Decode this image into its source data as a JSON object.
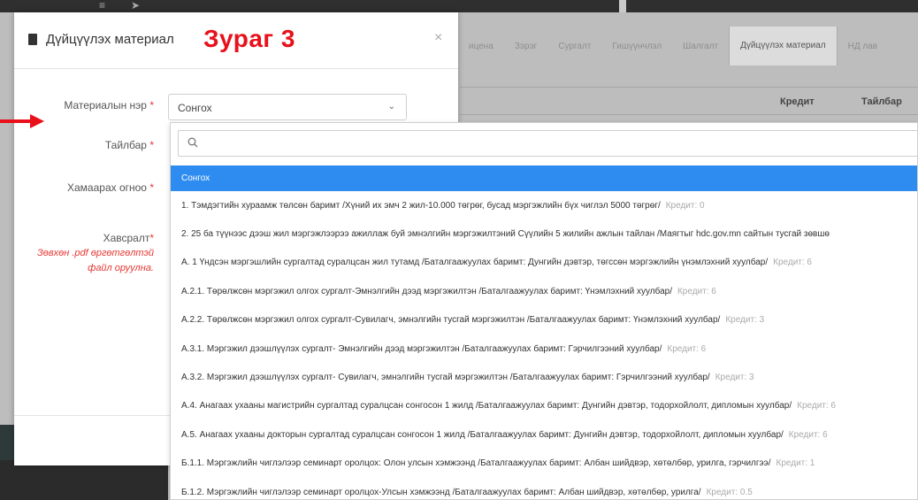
{
  "background": {
    "tabs": [
      {
        "label": "ицена",
        "active": false
      },
      {
        "label": "Зэрэг",
        "active": false
      },
      {
        "label": "Сургалт",
        "active": false
      },
      {
        "label": "Гишүүнчлэл",
        "active": false
      },
      {
        "label": "Шалгалт",
        "active": false
      },
      {
        "label": "Дүйцүүлэх материал",
        "active": true
      },
      {
        "label": "НД лав",
        "active": false
      }
    ],
    "table_headers": {
      "credit": "Кредит",
      "description": "Тайлбар"
    }
  },
  "modal": {
    "title": "Дүйцүүлэх материал",
    "close": "×"
  },
  "overlay_label": "Зураг 3",
  "form": {
    "material_name_label": "Материалын нэр",
    "description_label": "Тайлбар",
    "date_label": "Хамаарах огноо",
    "attachment_label": "Хавсралт",
    "required_mark": "*",
    "attachment_note": "Зөвхөн .pdf өргөтгөлтэй файл оруулна.",
    "select_value": "Сонгох"
  },
  "dropdown": {
    "search_value": "",
    "selected": "Сонгох",
    "credit_prefix": "Кредит:",
    "items": [
      {
        "text": "1. Тэмдэгтийн хураамж төлсөн баримт /Хүний их эмч 2 жил-10.000 төгрөг, бусад мэргэжлийн бүх чиглэл 5000 төгрөг/",
        "credit": "Кредит: 0"
      },
      {
        "text": "2. 25 ба түүнээс дээш жил мэргэжлээрээ ажиллаж буй эмнэлгийн мэргэжилтэний Сүүлийн 5 жилийн ажлын тайлан /Маягтыг hdc.gov.mn сайтын тусгай зөвшө",
        "credit": ""
      },
      {
        "text": "А. 1 Үндсэн мэргэшлийн сургалтад суралцсан жил тутамд /Баталгаажуулах баримт: Дунгийн дэвтэр, төгссөн мэргэжлийн үнэмлэхний хуулбар/",
        "credit": "Кредит: 6"
      },
      {
        "text": "А.2.1. Төрөлжсөн мэргэжил олгох сургалт-Эмнэлгийн дээд мэргэжилтэн /Баталгаажуулах баримт: Үнэмлэхний хуулбар/",
        "credit": "Кредит: 6"
      },
      {
        "text": "А.2.2. Төрөлжсөн мэргэжил олгох сургалт-Сувилагч, эмнэлгийн тусгай мэргэжилтэн /Баталгаажуулах баримт: Үнэмлэхний хуулбар/",
        "credit": "Кредит: 3"
      },
      {
        "text": "А.3.1. Мэргэжил дээшлүүлэх сургалт- Эмнэлгийн дээд мэргэжилтэн /Баталгаажуулах баримт: Гэрчилгээний хуулбар/",
        "credit": "Кредит: 6"
      },
      {
        "text": "А.3.2. Мэргэжил дээшлүүлэх сургалт- Сувилагч, эмнэлгийн тусгай мэргэжилтэн /Баталгаажуулах баримт: Гэрчилгээний хуулбар/",
        "credit": "Кредит: 3"
      },
      {
        "text": "А.4. Анагаах ухааны магистрийн сургалтад суралцсан сонгосон 1 жилд /Баталгаажуулах баримт: Дунгийн дэвтэр, тодорхойлолт, дипломын хуулбар/",
        "credit": "Кредит: 6"
      },
      {
        "text": "А.5. Анагаах ухааны докторын сургалтад суралцсан сонгосон 1 жилд /Баталгаажуулах баримт: Дунгийн дэвтэр, тодорхойлолт, дипломын хуулбар/",
        "credit": "Кредит: 6"
      },
      {
        "text": "Б.1.1. Мэргэжлийн чиглэлээр семинарт оролцох: Олон улсын хэмжээнд /Баталгаажуулах баримт: Албан шийдвэр, хөтөлбөр, урилга, гэрчилгээ/",
        "credit": "Кредит: 1"
      },
      {
        "text": "Б.1.2. Мэргэжлийн чиглэлээр семинарт оролцох-Улсын хэмжээнд /Баталгаажуулах баримт: Албан шийдвэр, хөтөлбөр, урилга/",
        "credit": "Кредит: 0.5"
      }
    ]
  },
  "colors": {
    "accent": "#2e8cf0",
    "annotation": "#e8101a",
    "required": "#e53935"
  }
}
